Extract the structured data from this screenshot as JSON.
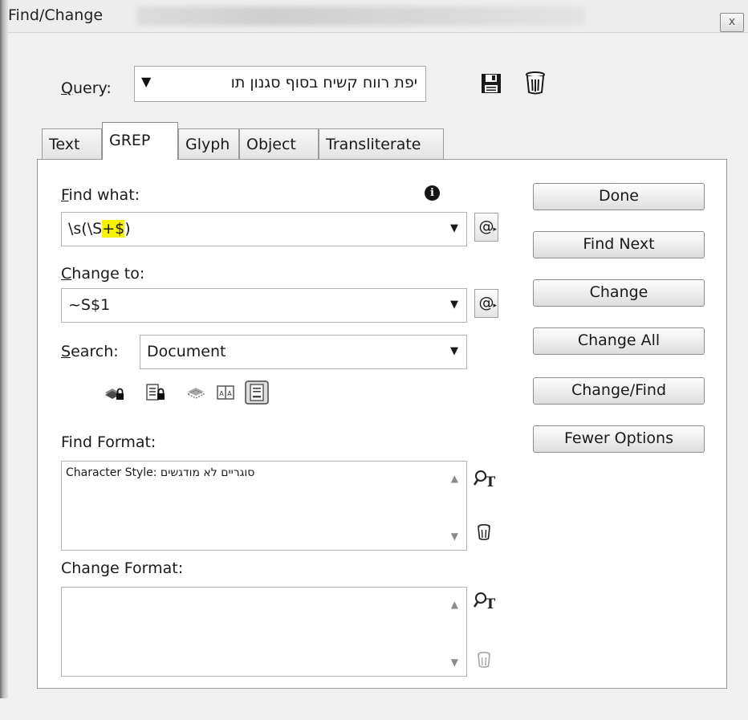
{
  "window": {
    "title": "Find/Change",
    "close_label": "x"
  },
  "query": {
    "label_accel": "Q",
    "label_rest": "uery:",
    "value": "יפת רווח קשיח בסוף סגנון תו"
  },
  "tabs": [
    {
      "label": "Text"
    },
    {
      "label": "GREP"
    },
    {
      "label": "Glyph"
    },
    {
      "label": "Object"
    },
    {
      "label": "Transliterate"
    }
  ],
  "find_what": {
    "label_accel": "F",
    "label_rest": "ind what:",
    "value_pre": "\\s(\\S",
    "value_highlight": "+$",
    "value_post": ")"
  },
  "change_to": {
    "label_accel": "C",
    "label_rest": "hange to:",
    "value": "~S$1"
  },
  "search": {
    "label_accel": "S",
    "label_rest": "earch:",
    "value": "Document"
  },
  "special_char_glyph": "@",
  "info_glyph": "i",
  "find_format": {
    "label": "Find Format:",
    "value": "Character Style: סוגריים לא מודגשים"
  },
  "change_format": {
    "label": "Change Format:",
    "value": ""
  },
  "buttons": {
    "done": "Done",
    "find_next": "Find Next",
    "change": "Change",
    "change_all": "Change All",
    "change_find": "Change/Find",
    "fewer_options": "Fewer Options"
  },
  "icons": {
    "save": "save-query-icon",
    "delete": "delete-query-icon",
    "locked_layers": "include-locked-layers-icon",
    "locked_stories": "include-locked-stories-icon",
    "hidden_layers": "include-hidden-layers-icon",
    "master_pages": "include-master-pages-icon",
    "footnotes": "include-footnotes-icon",
    "specify_format": "specify-attributes-icon",
    "clear_format": "clear-attributes-icon"
  },
  "colors": {
    "highlight": "#f7f200",
    "panel_bg": "#ffffff",
    "dialog_bg": "#f0f0f0"
  }
}
